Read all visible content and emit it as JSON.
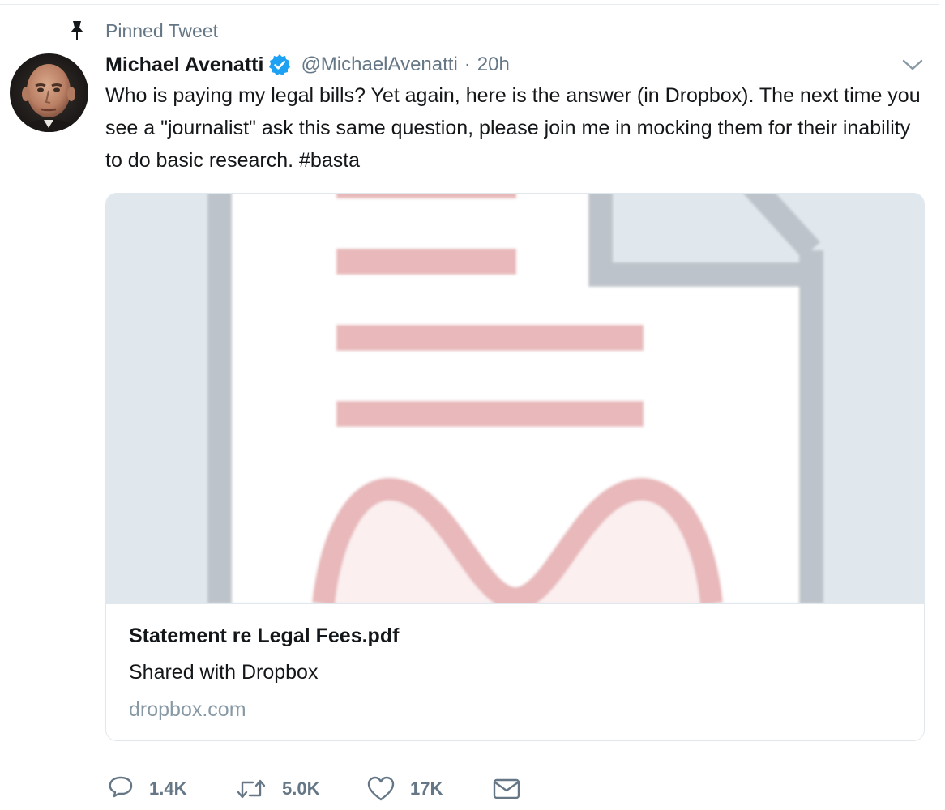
{
  "pinned": {
    "label": "Pinned Tweet",
    "icon": "pin-icon"
  },
  "tweet": {
    "author": {
      "name": "Michael Avenatti",
      "verified": true,
      "handle": "@MichaelAvenatti"
    },
    "separator": "·",
    "time": "20h",
    "text": "Who is paying my legal bills? Yet again, here is the answer (in Dropbox). The next time you see a \"journalist\" ask this same question, please join me in mocking them for their inability to do basic research. #basta"
  },
  "card": {
    "title": "Statement re Legal Fees.pdf",
    "description": "Shared with Dropbox",
    "domain": "dropbox.com"
  },
  "actions": {
    "reply_count": "1.4K",
    "retweet_count": "5.0K",
    "like_count": "17K"
  },
  "colors": {
    "text": "#14171a",
    "secondary": "#657786",
    "verified": "#1da1f2",
    "border": "#e1e8ed",
    "doc_lines": "#e8b8ba"
  }
}
